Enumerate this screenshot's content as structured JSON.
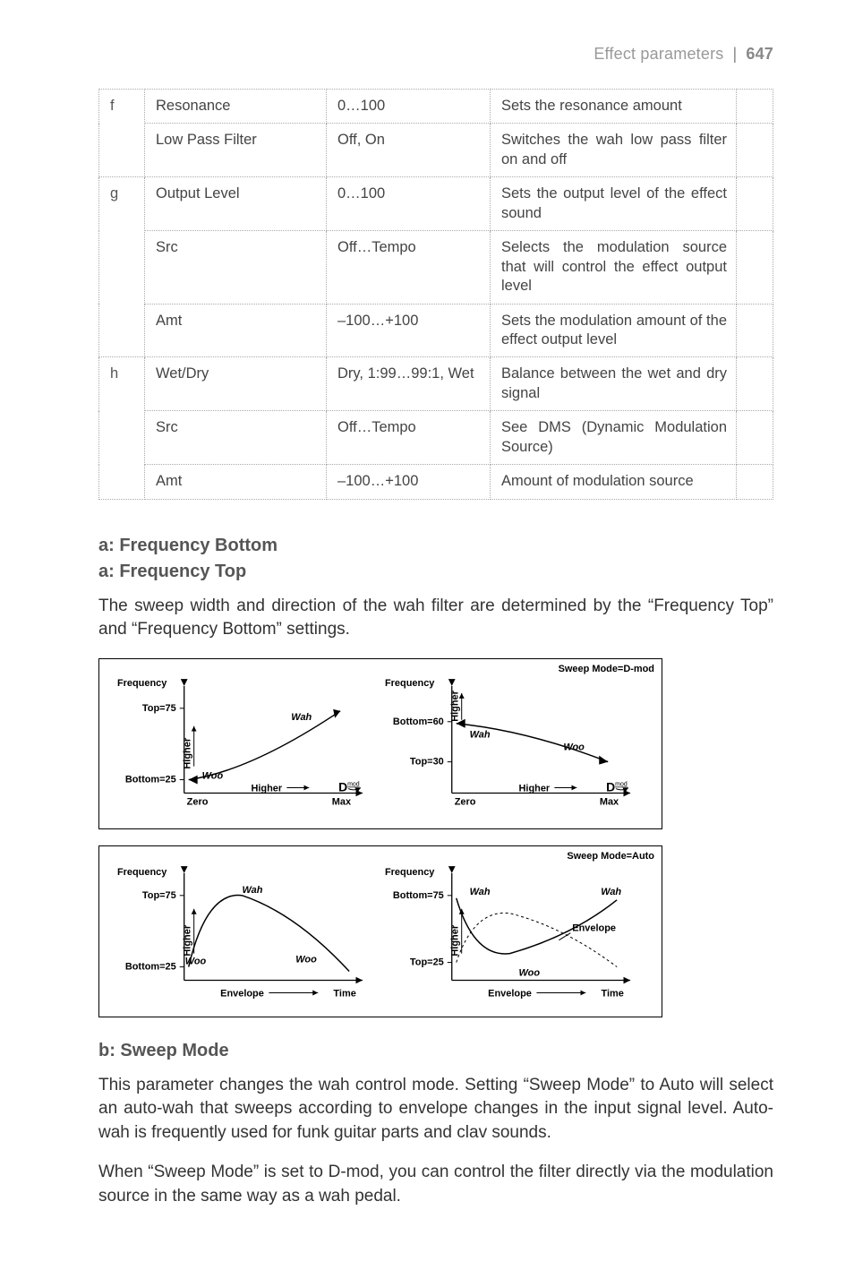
{
  "header": {
    "section": "Effect parameters",
    "separator": "|",
    "page_number": "647"
  },
  "table": [
    {
      "idx": "f",
      "rows": [
        {
          "name": "Resonance",
          "range": "0…100",
          "desc": "Sets the resonance amount"
        },
        {
          "name": "Low Pass Filter",
          "range": "Off, On",
          "desc": "Switches the wah low pass filter on and off"
        }
      ]
    },
    {
      "idx": "g",
      "rows": [
        {
          "name": "Output Level",
          "range": "0…100",
          "desc": "Sets the output level of the effect sound"
        },
        {
          "name": "Src",
          "range": "Off…Tempo",
          "desc": "Selects the modulation source that will control the effect output level"
        },
        {
          "name": "Amt",
          "range": "–100…+100",
          "desc": "Sets the modulation amount of the effect output level"
        }
      ]
    },
    {
      "idx": "h",
      "rows": [
        {
          "name": "Wet/Dry",
          "range": "Dry, 1:99…99:1, Wet",
          "desc": "Balance between the wet and dry signal"
        },
        {
          "name": "Src",
          "range": "Off…Tempo",
          "desc": "See DMS (Dynamic Modulation Source)"
        },
        {
          "name": "Amt",
          "range": "–100…+100",
          "desc": "Amount of modulation source"
        }
      ]
    }
  ],
  "headings": {
    "a1": "a: Frequency Bottom",
    "a2": "a: Frequency Top",
    "b": "b: Sweep Mode"
  },
  "paragraphs": {
    "p1": "The sweep width and direction of the wah filter are determined by the “Frequency Top” and “Frequency Bottom” settings.",
    "p2": "This parameter changes the wah control mode. Setting “Sweep Mode” to Auto will select an auto-wah that sweeps according to envelope changes in the input signal level. Auto-wah is frequently used for funk guitar parts and clav sounds.",
    "p3": "When “Sweep Mode” is set to D-mod, you can control the filter directly via the modulation source in the same way as a wah pedal."
  },
  "chart_data": [
    {
      "type": "line",
      "title": "Sweep Mode=D-mod",
      "panels": [
        {
          "ylabel": "Frequency",
          "xlabel": "",
          "y_ticks": [
            "Bottom=25",
            "Top=75"
          ],
          "x_ticks": [
            "Zero",
            "Max"
          ],
          "y_arrow_label": "Higher",
          "x_arrow_label": "Higher",
          "x_unit_icon": "D-mod",
          "curve_labels": [
            "Wah",
            "Woo"
          ],
          "series": [
            {
              "name": "filter-sweep",
              "x": [
                0,
                100
              ],
              "y": [
                25,
                75
              ]
            }
          ]
        },
        {
          "ylabel": "Frequency",
          "xlabel": "",
          "y_ticks": [
            "Top=30",
            "Bottom=60"
          ],
          "x_ticks": [
            "Zero",
            "Max"
          ],
          "y_arrow_label": "Higher",
          "x_arrow_label": "Higher",
          "x_unit_icon": "D-mod",
          "curve_labels": [
            "Wah",
            "Woo"
          ],
          "series": [
            {
              "name": "filter-sweep",
              "x": [
                0,
                100
              ],
              "y": [
                60,
                30
              ]
            }
          ]
        }
      ]
    },
    {
      "type": "line",
      "title": "Sweep Mode=Auto",
      "panels": [
        {
          "ylabel": "Frequency",
          "xlabel": "Time",
          "y_ticks": [
            "Bottom=25",
            "Top=75"
          ],
          "y_arrow_label": "Higher",
          "x_caption": "Envelope",
          "curve_labels": [
            "Wah",
            "Woo"
          ],
          "envelope_shown": true
        },
        {
          "ylabel": "Frequency",
          "xlabel": "Time",
          "y_ticks": [
            "Top=25",
            "Bottom=75"
          ],
          "y_arrow_label": "Higher",
          "x_caption": "Envelope",
          "curve_labels": [
            "Wah",
            "Woo",
            "Wah",
            "Envelope"
          ],
          "envelope_shown": true
        }
      ]
    }
  ]
}
